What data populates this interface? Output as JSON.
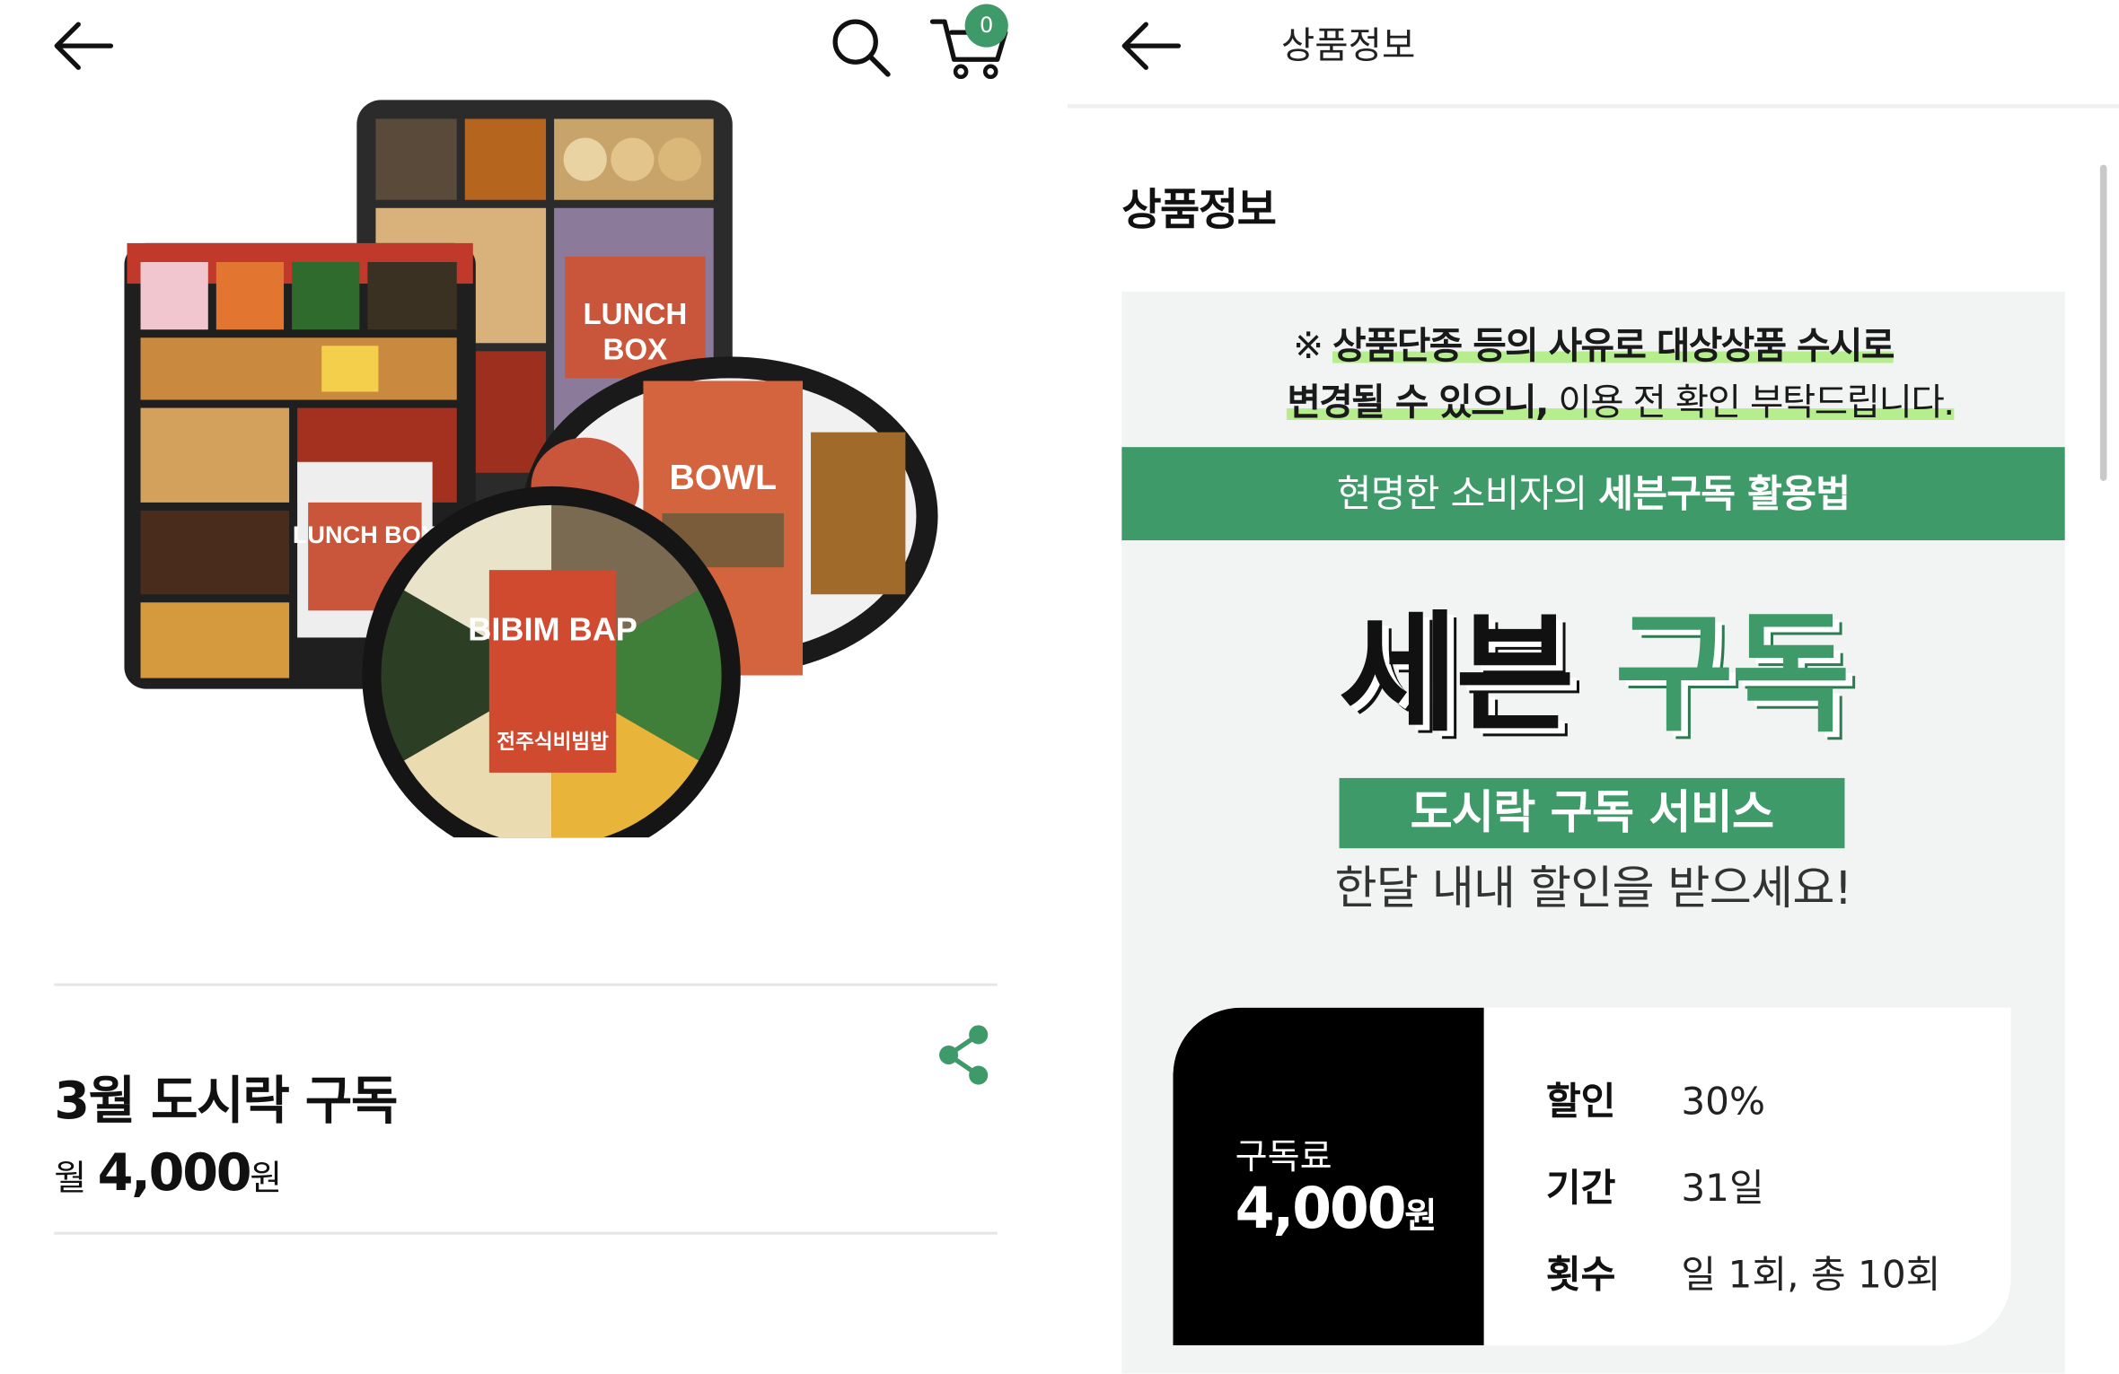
{
  "left": {
    "cart_count": "0",
    "product": {
      "title": "3월 도시락 구독",
      "price_prefix": "월",
      "price_amount": "4,000",
      "price_unit": "원"
    },
    "image_labels": {
      "lunch_box": "LUNCH BOX",
      "bowl": "BOWL",
      "bibimbap": "BIBIM BAP",
      "bibimbap_name": "전주식비빔밥"
    }
  },
  "right": {
    "header_title": "상품정보",
    "section_title": "상품정보",
    "notice": {
      "prefix": "※ ",
      "line1_highlight": "상품단종 등의 사유로 대상상품 수시로",
      "line2_highlight": "변경될 수 있으니,",
      "line2_rest": " 이용 전 확인 부탁드립니다."
    },
    "green_bar": {
      "normal": "현명한 소비자의 ",
      "bold": "세븐구독 활용법"
    },
    "big_title": {
      "word1": "세븐",
      "word2": "구독"
    },
    "pill": "도시락 구독 서비스",
    "subline": "한달 내내 할인을 받으세요!",
    "card": {
      "fee_label": "구독료",
      "fee_value": "4,000",
      "fee_unit": "원",
      "rows": [
        {
          "key": "할인",
          "value": "30%"
        },
        {
          "key": "기간",
          "value": "31일"
        },
        {
          "key": "횟수",
          "value": "일 1회, 총 10회"
        }
      ]
    }
  },
  "colors": {
    "brand_green": "#3f9a69",
    "highlight_green": "#b7ee8d",
    "banner_bg": "#f2f4f3"
  },
  "icons": [
    "back-arrow-icon",
    "search-icon",
    "cart-icon",
    "share-icon"
  ]
}
